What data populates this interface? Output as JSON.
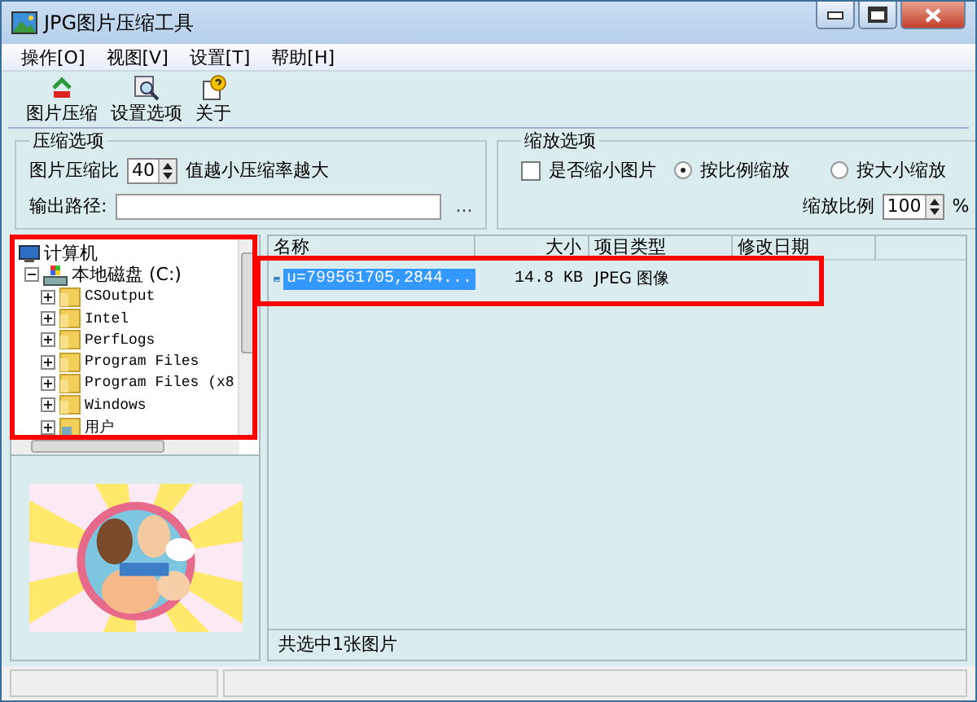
{
  "window": {
    "title": "JPG图片压缩工具"
  },
  "menu": [
    {
      "label": "操作[O]"
    },
    {
      "label": "视图[V]"
    },
    {
      "label": "设置[T]"
    },
    {
      "label": "帮助[H]"
    }
  ],
  "toolbar": [
    {
      "label": "图片压缩",
      "kind": "compress"
    },
    {
      "label": "设置选项",
      "kind": "settings"
    },
    {
      "label": "关于",
      "kind": "about"
    }
  ],
  "compression_options": {
    "title": "压缩选项",
    "ratio_label": "图片压缩比",
    "ratio_value": "40",
    "hint": "值越小压缩率越大",
    "output_label": "输出路径:",
    "browse": "..."
  },
  "scale_options": {
    "title": "缩放选项",
    "shrink": {
      "label": "是否缩小图片",
      "checked": false
    },
    "modes": [
      {
        "label": "按比例缩放",
        "selected": true
      },
      {
        "label": "按大小缩放",
        "selected": false
      }
    ],
    "scale_label": "缩放比例",
    "scale_value": "100",
    "unit": "%"
  },
  "tree": [
    {
      "label": "计算机",
      "kind": "computer",
      "children": [
        {
          "label": "本地磁盘 (C:)",
          "kind": "drive",
          "expanded": true,
          "children": [
            {
              "label": "CSOutput",
              "kind": "folder",
              "expanded": false
            },
            {
              "label": "Intel",
              "kind": "folder",
              "expanded": false
            },
            {
              "label": "PerfLogs",
              "kind": "folder",
              "expanded": false
            },
            {
              "label": "Program Files",
              "kind": "folder",
              "expanded": false
            },
            {
              "label": "Program Files (x8",
              "kind": "folder",
              "expanded": false
            },
            {
              "label": "Windows",
              "kind": "folder",
              "expanded": false
            },
            {
              "label": "用户",
              "kind": "user",
              "expanded": false
            }
          ]
        }
      ]
    }
  ],
  "file_list": {
    "columns": [
      "名称",
      "大小",
      "项目类型",
      "修改日期"
    ],
    "rows": [
      {
        "name": "u=799561705,2844...",
        "size": "14.8 KB",
        "type": "JPEG 图像",
        "selected": true
      }
    ],
    "summary": "共选中1张图片"
  }
}
